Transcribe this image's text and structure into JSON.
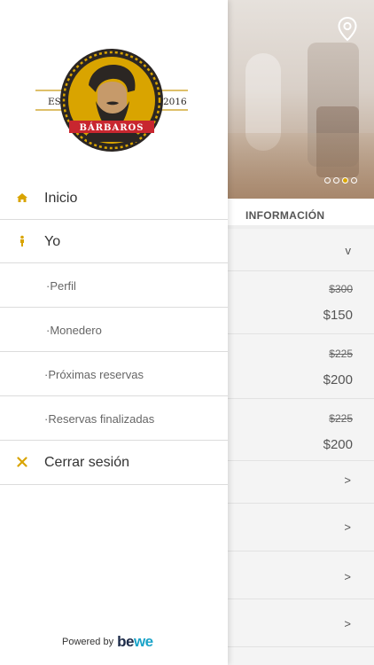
{
  "logo": {
    "text": "BÁRBAROS",
    "est_left": "EST.",
    "est_right": "2016"
  },
  "menu": {
    "items": [
      {
        "label": "Inicio",
        "icon": "home-icon"
      },
      {
        "label": "Yo",
        "icon": "person-icon"
      }
    ],
    "sub_items": [
      {
        "label": "·Perfil"
      },
      {
        "label": "·Monedero"
      },
      {
        "label": "·Próximas reservas"
      },
      {
        "label": "·Reservas finalizadas"
      }
    ],
    "logout": {
      "label": "Cerrar sesión",
      "icon": "close-icon"
    }
  },
  "footer": {
    "powered_by": "Powered by",
    "brand_be": "be",
    "brand_we": "we"
  },
  "right_panel": {
    "section_tab": "INFORMACIÓN",
    "dropdown_chevron": "v",
    "prices": [
      {
        "old": "$300",
        "new": "$150"
      },
      {
        "old": "$225",
        "new": "$200"
      },
      {
        "old": "$225",
        "new": "$200"
      }
    ],
    "row_chevron": ">",
    "carousel": {
      "total": 4,
      "active_index": 2
    }
  },
  "colors": {
    "accent": "#d9a400",
    "logo_red": "#c8262f",
    "logo_ring": "#2b2623"
  }
}
